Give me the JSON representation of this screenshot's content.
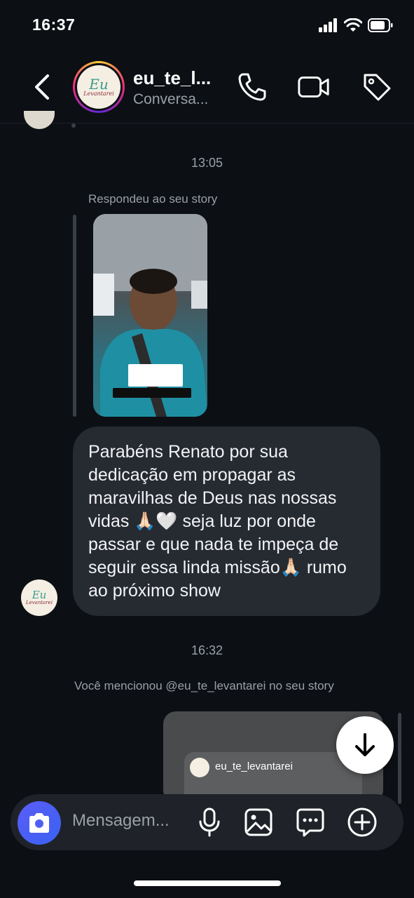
{
  "status_bar": {
    "time": "16:37",
    "icons": [
      "cellular-signal-icon",
      "wifi-icon",
      "battery-icon"
    ]
  },
  "header": {
    "back_icon": "chevron-left-icon",
    "avatar_text": {
      "line1": "Eu",
      "line2": "Levantarei"
    },
    "name": "eu_te_l...",
    "subtitle": "Conversa...",
    "actions": [
      "phone-icon",
      "video-camera-icon",
      "tag-icon"
    ]
  },
  "thread": {
    "timestamp_1": "13:05",
    "reply_note": "Respondeu ao seu story",
    "story_icon": "story-thumbnail",
    "message": "Parabéns Renato por sua dedicação em propagar as maravilhas de Deus nas nossas vidas 🙏🏻🤍 seja luz por onde passar e que nada te impeça de seguir essa linda missão🙏🏻 rumo ao próximo show",
    "timestamp_2": "16:32",
    "mention_note": "Você mencionou @eu_te_levantarei no seu story",
    "mention_card_user": "eu_te_levantarei"
  },
  "scroll_down_icon": "arrow-down-icon",
  "composer": {
    "placeholder": "Mensagem...",
    "camera_icon": "camera-icon",
    "actions": [
      "microphone-icon",
      "image-icon",
      "chat-bubble-icon",
      "plus-circle-icon"
    ]
  },
  "colors": {
    "background": "#0c0f14",
    "bubble": "#262a31",
    "muted_text": "#9aa0a8",
    "camera_button": "#4f5ff5"
  }
}
